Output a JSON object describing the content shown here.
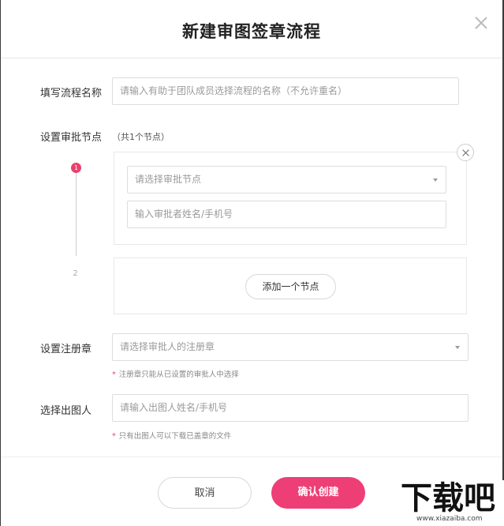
{
  "dialog": {
    "title": "新建审图签章流程"
  },
  "form": {
    "flow_name": {
      "label": "填写流程名称",
      "placeholder": "请输入有助于团队成员选择流程的名称（不允许重名）"
    },
    "approval": {
      "label": "设置审批节点",
      "count_text": "（共1个节点）",
      "nodes": [
        {
          "index": "1",
          "select_placeholder": "请选择审批节点",
          "approver_placeholder": "输入审批者姓名/手机号"
        },
        {
          "index": "2",
          "add_label": "添加一个节点"
        }
      ]
    },
    "seal": {
      "label": "设置注册章",
      "placeholder": "请选择审批人的注册章",
      "hint": "注册章只能从已设置的审批人中选择"
    },
    "issuer": {
      "label": "选择出图人",
      "placeholder": "请输入出图人姓名/手机号",
      "hint": "只有出图人可以下载已盖章的文件"
    }
  },
  "footer": {
    "cancel_label": "取消",
    "confirm_label": "确认创建"
  },
  "watermark": {
    "logo_text": "下载吧",
    "url": "www.xiazaiba.com"
  },
  "colors": {
    "accent": "#ed3f76",
    "active_node": "#e8426c"
  }
}
